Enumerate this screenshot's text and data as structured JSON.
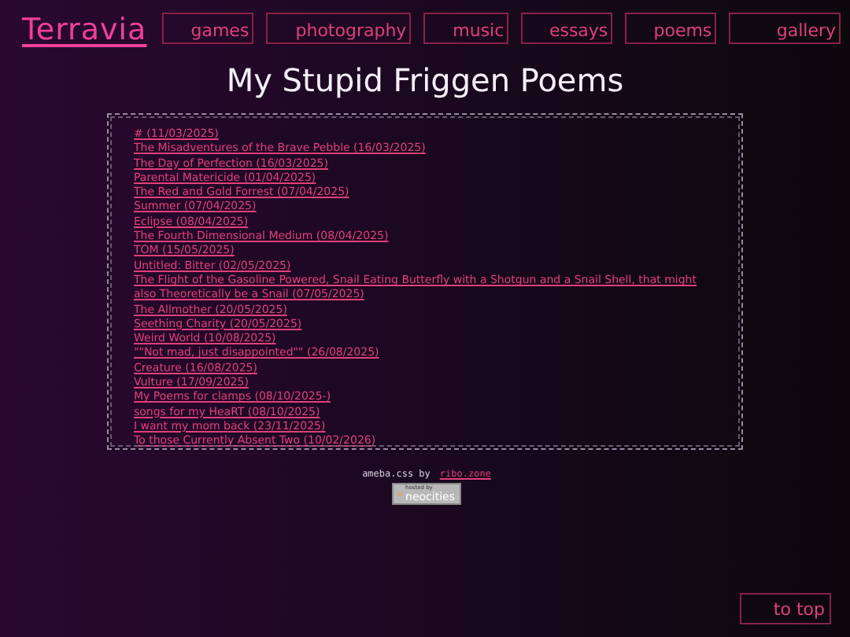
{
  "logo": "Terravia",
  "nav": [
    {
      "label": "games"
    },
    {
      "label": "photography"
    },
    {
      "label": "music"
    },
    {
      "label": "essays"
    },
    {
      "label": "poems"
    },
    {
      "label": "gallery"
    }
  ],
  "title": "My Stupid Friggen Poems",
  "poems": [
    "# (11/03/2025)",
    "The Misadventures of the Brave Pebble (16/03/2025)",
    "The Day of Perfection (16/03/2025)",
    "Parental Matericide (01/04/2025)",
    "The Red and Gold Forrest (07/04/2025)",
    "Summer (07/04/2025)",
    "Eclipse (08/04/2025)",
    "The Fourth Dimensional Medium (08/04/2025)",
    "TOM (15/05/2025)",
    "Untitled: Bitter (02/05/2025)",
    "The Flight of the Gasoline Powered, Snail Eating Butterfly with a Shotgun and a Snail Shell, that might also Theoretically be a Snail (07/05/2025)",
    "The Allmother (20/05/2025)",
    "Seething Charity (20/05/2025)",
    "Weird World (10/08/2025)",
    "\"\"Not mad, just disappointed\"\" (26/08/2025)",
    "Creature (16/08/2025)",
    "Vulture (17/09/2025)",
    "My Poems for clamps (08/10/2025-)",
    "songs for my HeaRT (08/10/2025)",
    "I want my mom back (23/11/2025)",
    "To those Currently Absent Two (10/02/2026)"
  ],
  "footer": {
    "text": "ameba.css by",
    "link": "ribo.zone",
    "badge_small": "hosted by",
    "badge": "neocities"
  },
  "to_top": "to top"
}
